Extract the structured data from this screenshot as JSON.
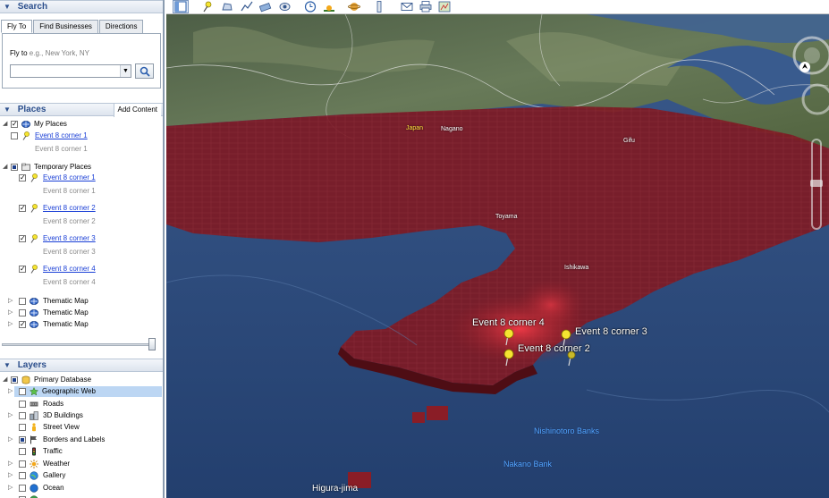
{
  "search": {
    "title": "Search",
    "tabs": [
      "Fly To",
      "Find Businesses",
      "Directions"
    ],
    "fly_label": "Fly to",
    "fly_hint": "e.g., New York, NY",
    "input_value": ""
  },
  "places": {
    "title": "Places",
    "add_content": "Add Content",
    "items": [
      {
        "label": "My Places",
        "sub": ""
      },
      {
        "label": "Event 8 corner 1",
        "sub": "Event 8 corner 1"
      },
      {
        "label": "Temporary Places",
        "sub": ""
      },
      {
        "label": "Event 8 corner 1",
        "sub": "Event 8 corner 1"
      },
      {
        "label": "Event 8 corner 2",
        "sub": "Event 8 corner 2"
      },
      {
        "label": "Event 8 corner 3",
        "sub": "Event 8 corner 3"
      },
      {
        "label": "Event 8 corner 4",
        "sub": "Event 8 corner 4"
      },
      {
        "label": "Thematic Map",
        "sub": ""
      },
      {
        "label": "Thematic Map",
        "sub": ""
      },
      {
        "label": "Thematic Map",
        "sub": ""
      }
    ]
  },
  "layers": {
    "title": "Layers",
    "items": [
      "Primary Database",
      "Geographic Web",
      "Roads",
      "3D Buildings",
      "Street View",
      "Borders and Labels",
      "Traffic",
      "Weather",
      "Gallery",
      "Ocean"
    ]
  },
  "map": {
    "city_labels": {
      "japan": "Japan",
      "nagano": "Nagano",
      "gifu": "Gifu",
      "toyama": "Toyama",
      "ishikawa": "Ishikawa"
    },
    "pin_labels": {
      "c4": "Event 8 corner 4",
      "c3": "Event 8 corner 3",
      "c2": "Event 8 corner 2"
    },
    "sea_labels": {
      "nishinotoro": "Nishinotoro Banks",
      "nakano": "Nakano Bank"
    },
    "island_label": "Higura-jima"
  },
  "colors": {
    "header_text": "#2c4f8c",
    "link": "#1a3fd6",
    "pin": "#f5e431",
    "heat": "#8a1d26",
    "sea": "#2d4d7f"
  }
}
